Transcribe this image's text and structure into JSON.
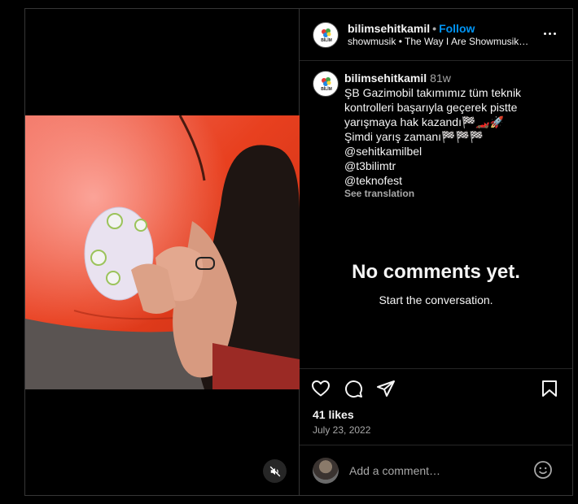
{
  "post": {
    "username": "bilimsehitkamil",
    "follow_label": "Follow",
    "audio_artist": "showmusik",
    "audio_title": "The Way I Are Showmusik…",
    "logo_text": "BİLİM"
  },
  "caption": {
    "username": "bilimsehitkamil",
    "time": "81w",
    "lines": [
      "ŞB Gazimobil takımımız tüm teknik",
      "kontrolleri başarıyla geçerek pistte",
      "yarışmaya hak kazandı🏁🏎️🚀",
      "Şimdi yarış zamanı🏁🏁🏁",
      "@sehitkamilbel",
      "@t3bilimtr",
      "@teknofest"
    ],
    "see_translation": "See translation"
  },
  "comments": {
    "empty_title": "No comments yet.",
    "empty_subtitle": "Start the conversation."
  },
  "engagement": {
    "likes": "41 likes",
    "date": "July 23, 2022"
  },
  "comment_box": {
    "placeholder": "Add a comment…"
  },
  "icons": {
    "like": "heart-icon",
    "comment": "comment-icon",
    "share": "paper-plane-icon",
    "save": "bookmark-icon",
    "mute": "speaker-muted-icon",
    "more": "more-options-icon",
    "emoji": "emoji-icon"
  }
}
